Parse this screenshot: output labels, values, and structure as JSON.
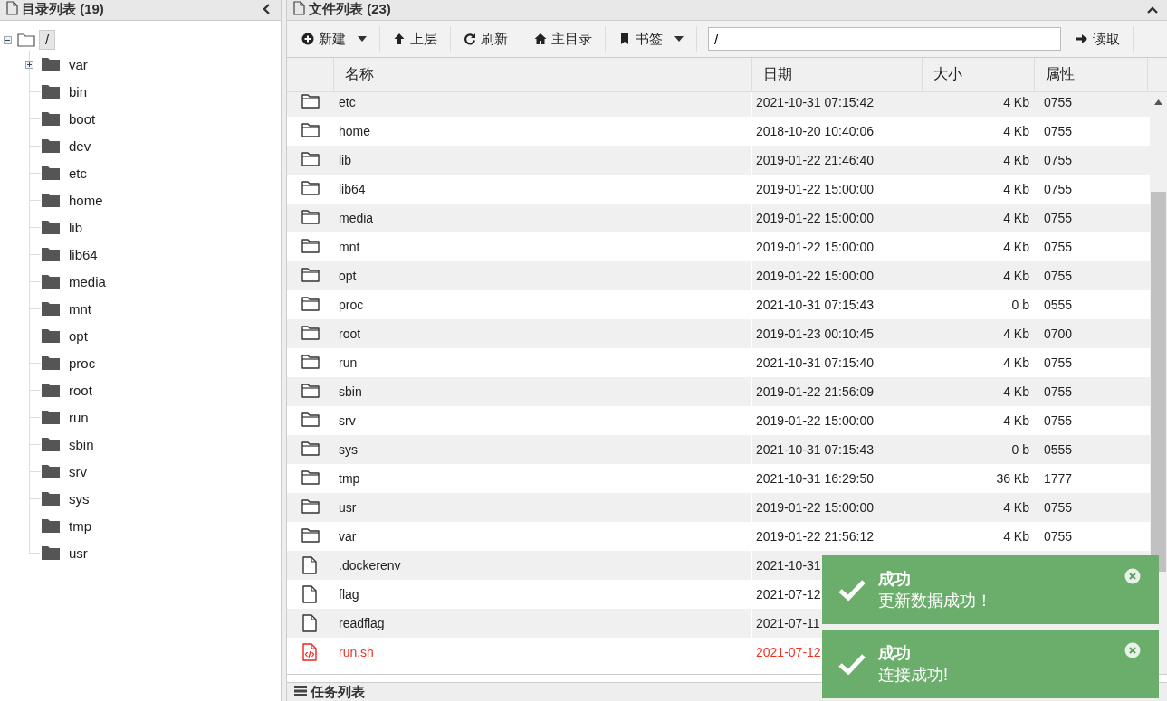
{
  "dir_panel": {
    "title": "目录列表 (19)",
    "tree": {
      "label": "/",
      "expanded": true,
      "selected": true,
      "children": [
        {
          "label": "var",
          "collapsed": true
        },
        {
          "label": "bin",
          "collapsed": false
        },
        {
          "label": "boot",
          "collapsed": false
        },
        {
          "label": "dev",
          "collapsed": false
        },
        {
          "label": "etc",
          "collapsed": false
        },
        {
          "label": "home",
          "collapsed": false
        },
        {
          "label": "lib",
          "collapsed": false
        },
        {
          "label": "lib64",
          "collapsed": false
        },
        {
          "label": "media",
          "collapsed": false
        },
        {
          "label": "mnt",
          "collapsed": false
        },
        {
          "label": "opt",
          "collapsed": false
        },
        {
          "label": "proc",
          "collapsed": false
        },
        {
          "label": "root",
          "collapsed": false
        },
        {
          "label": "run",
          "collapsed": false
        },
        {
          "label": "sbin",
          "collapsed": false
        },
        {
          "label": "srv",
          "collapsed": false
        },
        {
          "label": "sys",
          "collapsed": false
        },
        {
          "label": "tmp",
          "collapsed": false
        },
        {
          "label": "usr",
          "collapsed": false
        }
      ]
    }
  },
  "file_panel": {
    "title": "文件列表 (23)",
    "toolbar": [
      {
        "label": "新建",
        "dropdown": true
      },
      {
        "label": "上层",
        "dropdown": false
      },
      {
        "label": "刷新",
        "dropdown": false
      },
      {
        "label": "主目录",
        "dropdown": false
      },
      {
        "label": "书签",
        "dropdown": true
      }
    ],
    "path_field": {
      "value": "/"
    },
    "read_button": "读取",
    "table": {
      "columns": [
        "名称",
        "日期",
        "大小",
        "属性"
      ],
      "rows": [
        {
          "kind": "folder",
          "name": "etc",
          "date": "2021-10-31 07:15:42",
          "size": "4 Kb",
          "mode": "0755"
        },
        {
          "kind": "folder",
          "name": "home",
          "date": "2018-10-20 10:40:06",
          "size": "4 Kb",
          "mode": "0755"
        },
        {
          "kind": "folder",
          "name": "lib",
          "date": "2019-01-22 21:46:40",
          "size": "4 Kb",
          "mode": "0755"
        },
        {
          "kind": "folder",
          "name": "lib64",
          "date": "2019-01-22 15:00:00",
          "size": "4 Kb",
          "mode": "0755"
        },
        {
          "kind": "folder",
          "name": "media",
          "date": "2019-01-22 15:00:00",
          "size": "4 Kb",
          "mode": "0755"
        },
        {
          "kind": "folder",
          "name": "mnt",
          "date": "2019-01-22 15:00:00",
          "size": "4 Kb",
          "mode": "0755"
        },
        {
          "kind": "folder",
          "name": "opt",
          "date": "2019-01-22 15:00:00",
          "size": "4 Kb",
          "mode": "0755"
        },
        {
          "kind": "folder",
          "name": "proc",
          "date": "2021-10-31 07:15:43",
          "size": "0 b",
          "mode": "0555"
        },
        {
          "kind": "folder",
          "name": "root",
          "date": "2019-01-23 00:10:45",
          "size": "4 Kb",
          "mode": "0700"
        },
        {
          "kind": "folder",
          "name": "run",
          "date": "2021-10-31 07:15:40",
          "size": "4 Kb",
          "mode": "0755"
        },
        {
          "kind": "folder",
          "name": "sbin",
          "date": "2019-01-22 21:56:09",
          "size": "4 Kb",
          "mode": "0755"
        },
        {
          "kind": "folder",
          "name": "srv",
          "date": "2019-01-22 15:00:00",
          "size": "4 Kb",
          "mode": "0755"
        },
        {
          "kind": "folder",
          "name": "sys",
          "date": "2021-10-31 07:15:43",
          "size": "0 b",
          "mode": "0555"
        },
        {
          "kind": "folder",
          "name": "tmp",
          "date": "2021-10-31 16:29:50",
          "size": "36 Kb",
          "mode": "1777"
        },
        {
          "kind": "folder",
          "name": "usr",
          "date": "2019-01-22 15:00:00",
          "size": "4 Kb",
          "mode": "0755"
        },
        {
          "kind": "folder",
          "name": "var",
          "date": "2019-01-22 21:56:12",
          "size": "4 Kb",
          "mode": "0755"
        },
        {
          "kind": "file",
          "name": ".dockerenv",
          "date": "2021-10-31"
        },
        {
          "kind": "file",
          "name": "flag",
          "date": "2021-07-12"
        },
        {
          "kind": "file",
          "name": "readflag",
          "date": "2021-07-11"
        },
        {
          "kind": "script",
          "name": "run.sh",
          "date": "2021-07-12"
        }
      ]
    }
  },
  "task_panel": {
    "title": "任务列表"
  },
  "toasts": [
    {
      "title": "成功",
      "message": "更新数据成功！"
    },
    {
      "title": "成功",
      "message": "连接成功!"
    }
  ]
}
